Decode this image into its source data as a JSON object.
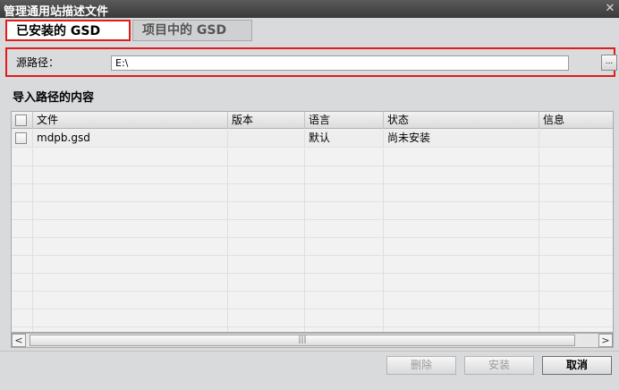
{
  "window": {
    "title": "管理通用站描述文件",
    "close_glyph": "✕"
  },
  "tabs": [
    {
      "label": "已安装的 GSD",
      "active": true
    },
    {
      "label": "项目中的 GSD",
      "active": false
    }
  ],
  "source": {
    "label": "源路径：",
    "value": "E:\\",
    "browse_label": "..."
  },
  "content": {
    "section_title": "导入路径的内容",
    "columns": [
      "文件",
      "版本",
      "语言",
      "状态",
      "信息"
    ],
    "rows": [
      {
        "file": "mdpb.gsd",
        "version": "",
        "language": "默认",
        "status": "尚未安装",
        "info": ""
      }
    ]
  },
  "scrollbar": {
    "left_glyph": "<",
    "right_glyph": ">",
    "thumb_glyph": "|||"
  },
  "buttons": {
    "delete": "删除",
    "install": "安装",
    "cancel": "取消"
  },
  "colors": {
    "highlight": "#e21b1b",
    "titlebar": "#4a4a4a",
    "dialog_bg": "#d9dadb"
  }
}
